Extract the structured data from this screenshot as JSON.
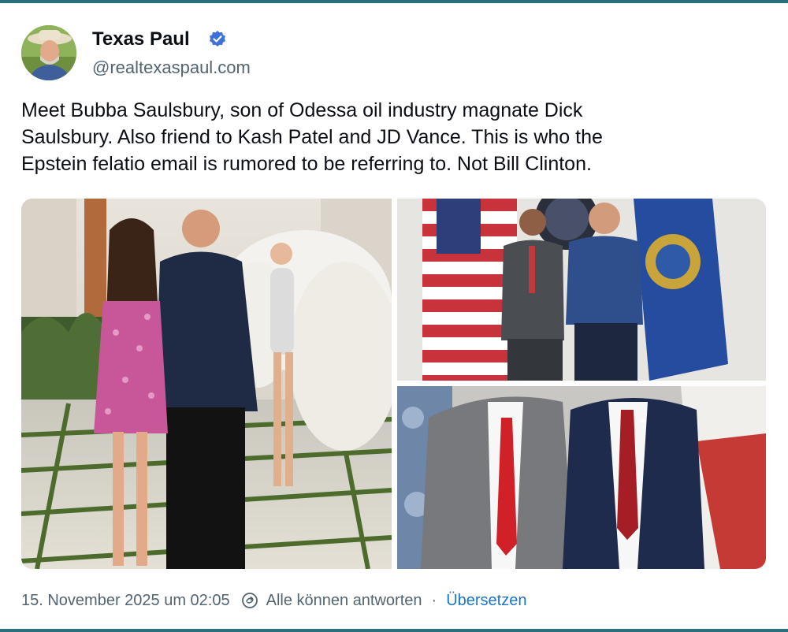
{
  "post": {
    "author": {
      "display_name": "Texas Paul",
      "handle": "@realtexaspaul.com",
      "verified": true
    },
    "text": "Meet Bubba Saulsbury, son of Odessa oil industry magnate Dick\nSaulsbury.  Also friend to Kash Patel and JD Vance.  This is who the\nEpstein felatio email is rumored to be referring to.  Not Bill Clinton.",
    "media": [
      {
        "icon": "photo-party"
      },
      {
        "icon": "photo-flags"
      },
      {
        "icon": "photo-suits"
      }
    ],
    "footer": {
      "timestamp": "15. November 2025 um 02:05",
      "reply_setting": "Alle können antworten",
      "separator": "·",
      "translate_label": "Übersetzen"
    }
  },
  "colors": {
    "accent": "#1d73c9",
    "verified_badge": "#3f6fd8",
    "secondary_text": "#536471",
    "frame": "#2b6f7c"
  }
}
